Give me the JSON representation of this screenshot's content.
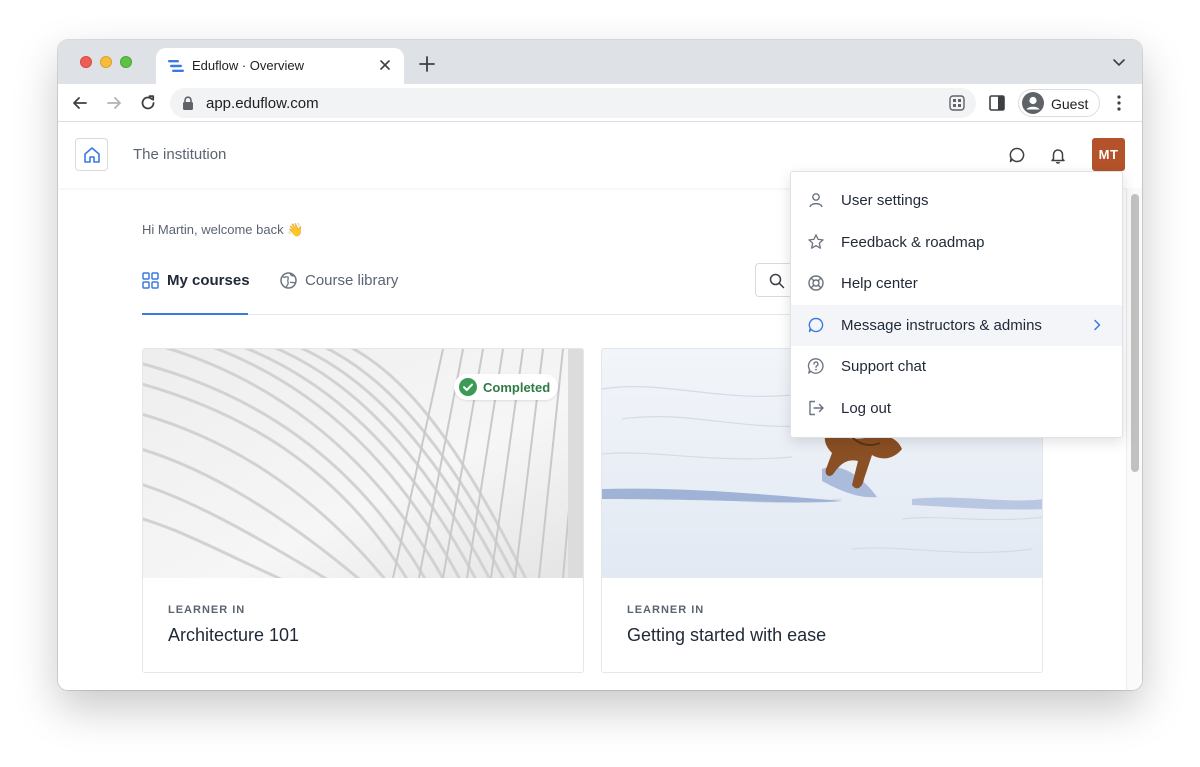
{
  "browser": {
    "tab_title": "Eduflow · Overview",
    "url": "app.eduflow.com",
    "profile_label": "Guest"
  },
  "header": {
    "institution": "The institution",
    "avatar_initials": "MT"
  },
  "main": {
    "welcome": "Hi Martin, welcome back 👋",
    "tabs": [
      {
        "label": "My courses",
        "icon": "grid-icon",
        "active": true
      },
      {
        "label": "Course library",
        "icon": "globe-icon",
        "active": false
      }
    ]
  },
  "courses": [
    {
      "role": "LEARNER IN",
      "title": "Architecture 101",
      "badge": "Completed"
    },
    {
      "role": "LEARNER IN",
      "title": "Getting started with ease",
      "badge": ""
    }
  ],
  "user_menu": {
    "items": [
      {
        "label": "User settings",
        "icon": "user-icon"
      },
      {
        "label": "Feedback & roadmap",
        "icon": "star-icon"
      },
      {
        "label": "Help center",
        "icon": "lifebuoy-icon"
      },
      {
        "label": "Message instructors & admins",
        "icon": "chat-bubble-icon",
        "has_submenu": true
      },
      {
        "label": "Support chat",
        "icon": "question-bubble-icon"
      },
      {
        "label": "Log out",
        "icon": "logout-icon"
      }
    ]
  },
  "colors": {
    "accent": "#3b7ae0",
    "avatar_bg": "#b4522a",
    "completed_green": "#3a9a56"
  }
}
